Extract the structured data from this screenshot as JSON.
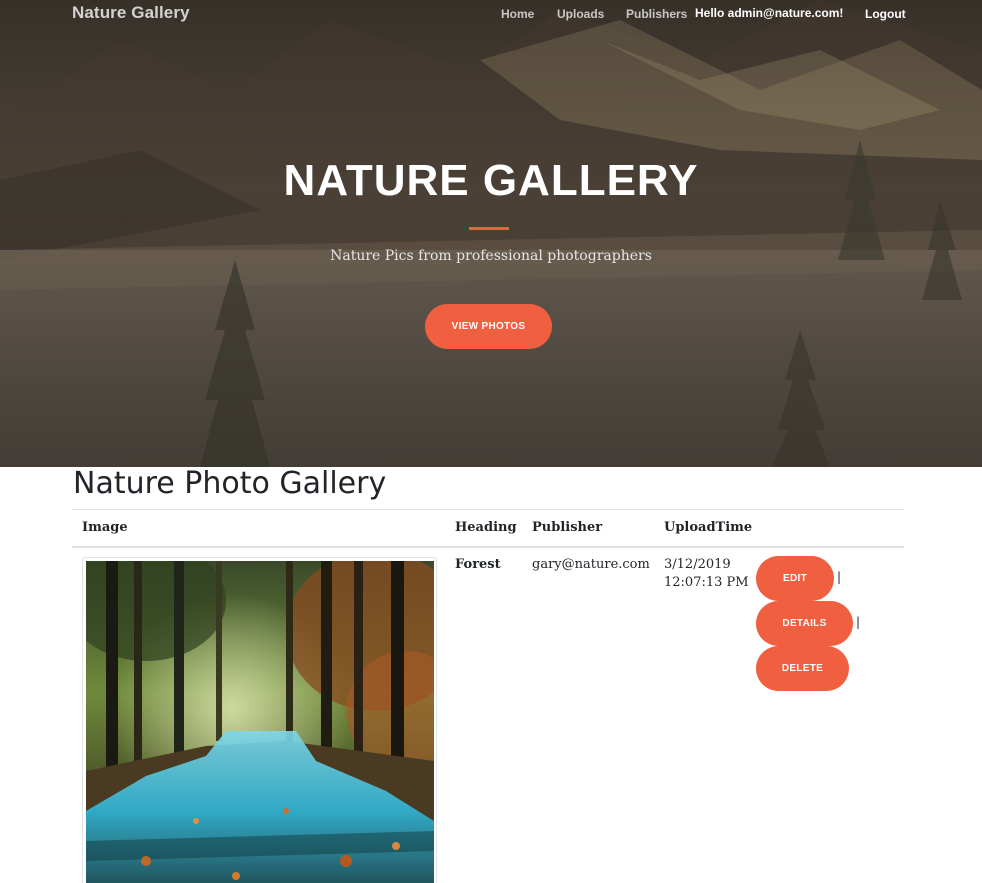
{
  "navbar": {
    "brand": "Nature Gallery",
    "links": [
      "Home",
      "Uploads",
      "Publishers"
    ],
    "greeting": "Hello admin@nature.com!",
    "logout": "Logout"
  },
  "hero": {
    "title": "NATURE GALLERY",
    "subtitle": "Nature Pics from professional photographers",
    "button": "VIEW PHOTOS"
  },
  "main": {
    "title": "Nature Photo Gallery",
    "columns": [
      "Image",
      "Heading",
      "Publisher",
      "UploadTime"
    ],
    "rows": [
      {
        "image": "forest-stream-photo",
        "heading": "Forest",
        "publisher": "gary@nature.com",
        "date": "3/12/2019",
        "time": "12:07:13 PM",
        "actions": [
          "EDIT",
          "DETAILS",
          "DELETE"
        ],
        "separator": "|"
      }
    ]
  },
  "colors": {
    "accent": "#f05f40",
    "text": "#212529",
    "rule": "#dee2e6"
  }
}
